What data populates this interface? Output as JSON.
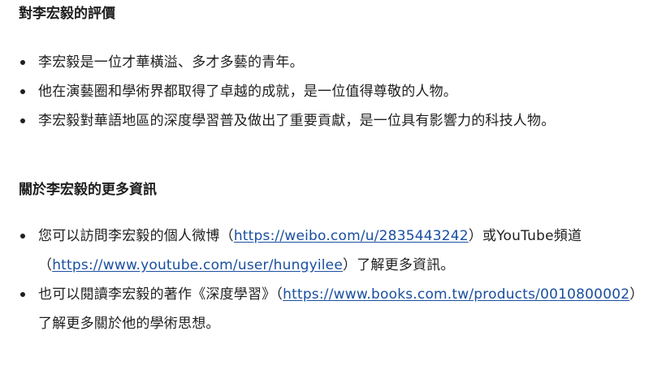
{
  "section1": {
    "title": "對李宏毅的評價",
    "items": [
      {
        "text": "李宏毅是一位才華橫溢、多才多藝的青年。"
      },
      {
        "text": "他在演藝圈和學術界都取得了卓越的成就，是一位值得尊敬的人物。"
      },
      {
        "text": "李宏毅對華語地區的深度學習普及做出了重要貢獻，是一位具有影響力的科技人物。"
      }
    ]
  },
  "section2": {
    "title": "關於李宏毅的更多資訊",
    "item1": {
      "prefix": "您可以訪問李宏毅的個人微博（",
      "weibo_url": "https://weibo.com/u/2835443242",
      "middle": "）或YouTube頻道（",
      "youtube_url": "https://www.youtube.com/user/hungyilee",
      "suffix": "）了解更多資訊。"
    },
    "item2": {
      "prefix": "也可以閱讀李宏毅的著作《深度學習》（",
      "books_url": "https://www.books.com.tw/products/0010800002",
      "suffix": "）了解更多關於他的學術思想。"
    }
  },
  "colors": {
    "text": "#1f1f1f",
    "link": "#1a4fa0"
  }
}
